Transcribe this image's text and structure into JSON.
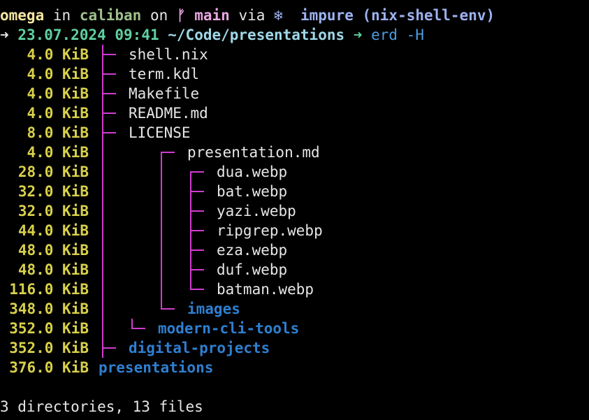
{
  "prompt": {
    "user": "omega",
    "in_word": "in",
    "host": "caliban",
    "on_word": "on",
    "branch_icon": "git-branch-icon",
    "branch_glyph": "ᚠ",
    "branch": "main",
    "via_word": "via",
    "nix_icon": "snowflake-icon",
    "nix_glyph": "❄",
    "env": "impure (nix-shell-env)",
    "arrow_glyph": "➜",
    "datetime": "23.07.2024 09:41",
    "cwd": "~/Code/presentations",
    "cmd_arrow": "➜",
    "command": "erd",
    "command_flag": "-H"
  },
  "tree": [
    {
      "size": "4.0 KiB",
      "name": "shell.nix",
      "type": "file"
    },
    {
      "size": "4.0 KiB",
      "name": "term.kdl",
      "type": "file"
    },
    {
      "size": "4.0 KiB",
      "name": "Makefile",
      "type": "file"
    },
    {
      "size": "4.0 KiB",
      "name": "README.md",
      "type": "file"
    },
    {
      "size": "8.0 KiB",
      "name": "LICENSE",
      "type": "file"
    },
    {
      "size": "4.0 KiB",
      "name": "presentation.md",
      "type": "file"
    },
    {
      "size": "28.0 KiB",
      "name": "dua.webp",
      "type": "file"
    },
    {
      "size": "32.0 KiB",
      "name": "bat.webp",
      "type": "file"
    },
    {
      "size": "32.0 KiB",
      "name": "yazi.webp",
      "type": "file"
    },
    {
      "size": "44.0 KiB",
      "name": "ripgrep.webp",
      "type": "file"
    },
    {
      "size": "48.0 KiB",
      "name": "eza.webp",
      "type": "file"
    },
    {
      "size": "48.0 KiB",
      "name": "duf.webp",
      "type": "file"
    },
    {
      "size": "116.0 KiB",
      "name": "batman.webp",
      "type": "file"
    },
    {
      "size": "348.0 KiB",
      "name": "images",
      "type": "dir"
    },
    {
      "size": "352.0 KiB",
      "name": "modern-cli-tools",
      "type": "dir"
    },
    {
      "size": "352.0 KiB",
      "name": "digital-projects",
      "type": "dir"
    },
    {
      "size": "376.0 KiB",
      "name": "presentations",
      "type": "dir"
    }
  ],
  "summary": "3 directories, 13 files",
  "colors": {
    "user": "#f2e6a0",
    "host": "#9fbf8a",
    "branch": "#e9a6e0",
    "env": "#9db2f0",
    "datetime": "#5fd0a0",
    "cwd": "#9fd8e8",
    "command": "#4c9be0",
    "size": "#d8d04a",
    "tree_lines": "#d03cd0",
    "dir": "#2f7fd0"
  }
}
